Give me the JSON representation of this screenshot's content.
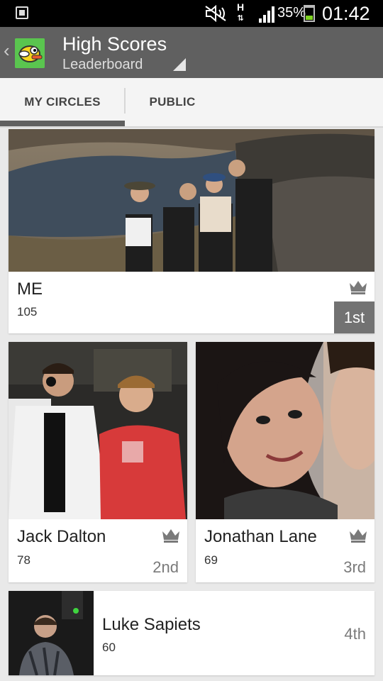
{
  "status_bar": {
    "notification_icon": "app-notification-icon",
    "network_type": "H",
    "battery_percent": "35%",
    "battery_level": 0.35,
    "time": "01:42"
  },
  "action_bar": {
    "title": "High Scores",
    "subtitle": "Leaderboard",
    "back_icon": "chevron-left-icon",
    "app_icon": "flappy-bird-icon"
  },
  "tabs": [
    {
      "label": "MY CIRCLES",
      "selected": true
    },
    {
      "label": "PUBLIC",
      "selected": false
    }
  ],
  "leaderboard": [
    {
      "name": "ME",
      "score": "105",
      "rank": "1st",
      "crown": true
    },
    {
      "name": "Jack Dalton",
      "score": "78",
      "rank": "2nd",
      "crown": true
    },
    {
      "name": "Jonathan Lane",
      "score": "69",
      "rank": "3rd",
      "crown": true
    },
    {
      "name": "Luke Sapiets",
      "score": "60",
      "rank": "4th",
      "crown": false
    }
  ],
  "colors": {
    "action_bar": "#606060",
    "status_bar": "#000000",
    "battery": "#7ed321",
    "rank_badge": "#727272"
  }
}
